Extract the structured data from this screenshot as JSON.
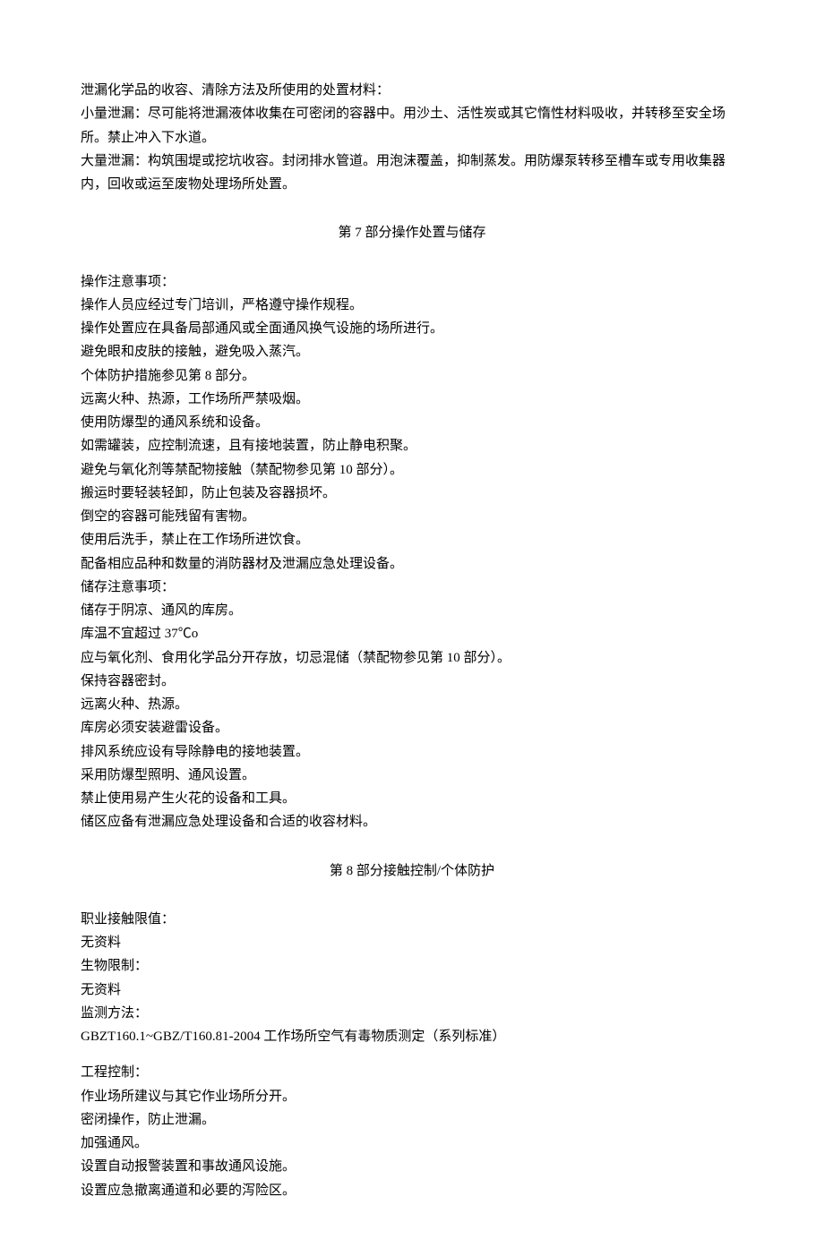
{
  "section6_tail": {
    "p1": "泄漏化学品的收容、清除方法及所使用的处置材料：",
    "p2": "小量泄漏：尽可能将泄漏液体收集在可密闭的容器中。用沙土、活性炭或其它惰性材料吸收，并转移至安全场所。禁止冲入下水道。",
    "p3": "大量泄漏：构筑围堤或挖坑收容。封闭排水管道。用泡沫覆盖，抑制蒸发。用防爆泵转移至槽车或专用收集器内，回收或运至废物处理场所处置。"
  },
  "section7": {
    "heading": "第 7 部分操作处置与储存",
    "ops_label": "操作注意事项：",
    "ops": [
      "操作人员应经过专门培训，严格遵守操作规程。",
      "操作处置应在具备局部通风或全面通风换气设施的场所进行。",
      "避免眼和皮肤的接触，避免吸入蒸汽。",
      "个体防护措施参见第 8 部分。",
      "远离火种、热源，工作场所严禁吸烟。",
      "使用防爆型的通风系统和设备。",
      "如需罐装，应控制流速，且有接地装置，防止静电积聚。",
      "避免与氧化剂等禁配物接触（禁配物参见第 10 部分）。",
      "搬运时要轻装轻卸，防止包装及容器损坏。",
      "倒空的容器可能残留有害物。",
      "使用后洗手，禁止在工作场所进饮食。",
      "配备相应品种和数量的消防器材及泄漏应急处理设备。"
    ],
    "storage_label": "储存注意事项：",
    "storage": [
      "储存于阴凉、通风的库房。",
      "库温不宜超过 37℃o",
      "应与氧化剂、食用化学品分开存放，切忌混储（禁配物参见第 10 部分）。",
      "保持容器密封。",
      "远离火种、热源。",
      "库房必须安装避雷设备。",
      "排风系统应设有导除静电的接地装置。",
      "采用防爆型照明、通风设置。",
      "禁止使用易产生火花的设备和工具。",
      "储区应备有泄漏应急处理设备和合适的收容材料。"
    ]
  },
  "section8": {
    "heading": "第 8 部分接触控制/个体防护",
    "oel_label": "职业接触限值：",
    "oel_value": "无资料",
    "bio_label": "生物限制：",
    "bio_value": "无资料",
    "monitor_label": "监测方法：",
    "monitor_value": "GBZT160.1~GBZ/T160.81-2004 工作场所空气有毒物质测定（系列标准）",
    "eng_label": "工程控制：",
    "eng": [
      "作业场所建议与其它作业场所分开。",
      "密闭操作，防止泄漏。",
      "加强通风。",
      "设置自动报警装置和事故通风设施。",
      "设置应急撤离通道和必要的泻险区。"
    ]
  }
}
